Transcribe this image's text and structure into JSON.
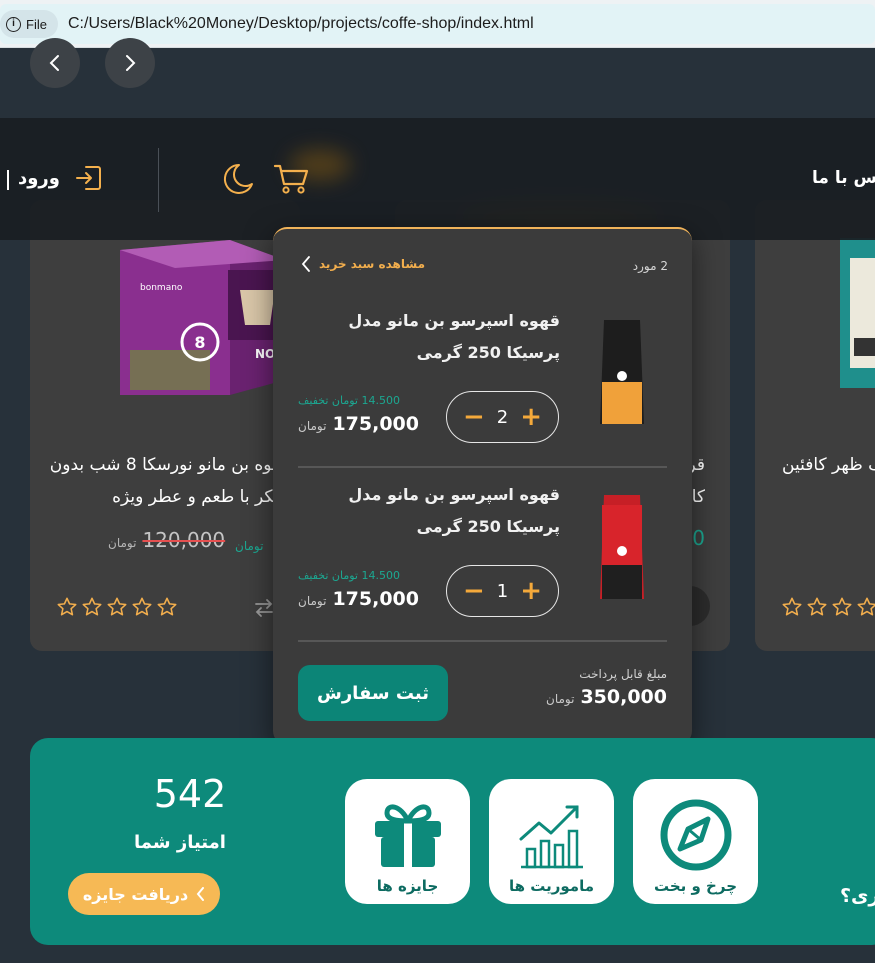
{
  "browser": {
    "file_chip": "File",
    "url": "C:/Users/Black%20Money/Desktop/projects/coffe-shop/index.html"
  },
  "header": {
    "login_label": "ورود",
    "contact_label": "تماس با ما",
    "icons": [
      "login-icon",
      "moon-icon",
      "cart-icon"
    ]
  },
  "products": {
    "left": {
      "brand": "bonmano",
      "box_text": "NORESCA",
      "title_line1": "قهوه بن مانو نورسکا 8 شب بدون",
      "title_line2": "شکر با طعم و عطر ویژه",
      "old_price": "120,000",
      "currency": "تومان",
      "rating_max": 5
    },
    "middle": {
      "title_line1": "قر",
      "title_line2": "کا"
    },
    "right": {
      "title_line1": "قهوه ترک ظهر کافئین"
    }
  },
  "cart": {
    "count_label": "2 مورد",
    "view_cart_label": "مشاهده سبد خرید",
    "items": [
      {
        "title": "قهوه اسپرسو بن مانو مدل پرسیکا 250 گرمی",
        "quantity": "2",
        "discount": "14.500 تومان تخفیف",
        "price": "175,000",
        "currency": "تومان",
        "bag_color": "#f0a13a"
      },
      {
        "title": "قهوه اسپرسو بن مانو مدل پرسیکا 250 گرمی",
        "quantity": "1",
        "discount": "14.500 تومان تخفیف",
        "price": "175,000",
        "currency": "تومان",
        "bag_color": "#d8242b"
      }
    ],
    "total_label": "مبلغ قابل پرداخت",
    "total": "350,000",
    "total_currency": "تومان",
    "order_button": "ثبت سفارش"
  },
  "rewards": {
    "score": "542",
    "score_label": "امتیاز شما",
    "reward_button": "دریافت جایزه",
    "tiles": [
      {
        "label": "جایزه ها",
        "icon": "gift-icon"
      },
      {
        "label": "ماموریت ها",
        "icon": "chart-icon"
      },
      {
        "label": "چرخ و بخت",
        "icon": "compass-icon"
      }
    ],
    "question_text": "ری؟"
  },
  "colors": {
    "accent_orange": "#f2ae4d",
    "teal": "#0d8a7b",
    "discount_teal": "#1ca791"
  }
}
